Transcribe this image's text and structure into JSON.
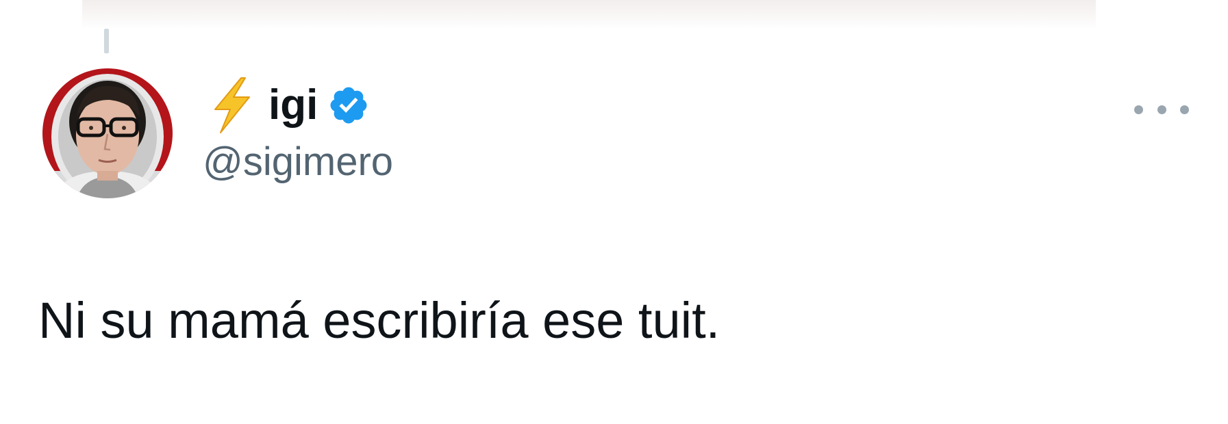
{
  "tweet": {
    "author": {
      "emoji_icon": "lightning-bolt-icon",
      "display_name": "igi",
      "verified_icon": "verified-badge-icon",
      "verified_color": "#1d9bf0",
      "handle": "@sigimero",
      "avatar_icon": "profile-photo"
    },
    "more_icon": "more-options-icon",
    "text": "Ni su mamá escribiría ese tuit.",
    "colors": {
      "text_primary": "#0f1419",
      "text_secondary": "#536471",
      "background": "#ffffff"
    }
  }
}
